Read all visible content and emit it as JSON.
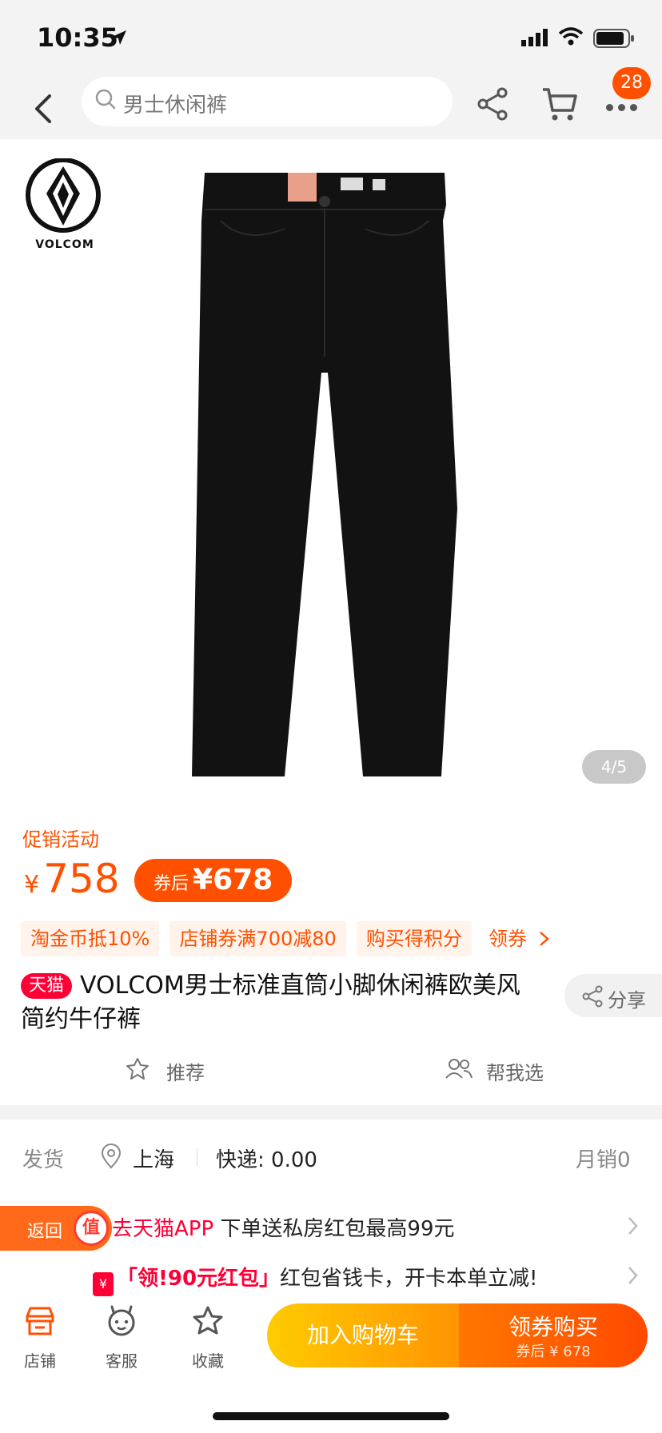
{
  "status_bar": {
    "time": "10:35"
  },
  "nav": {
    "search_placeholder": "男士休闲裤",
    "more_badge": "28"
  },
  "product": {
    "brand": "VOLCOM",
    "image_pager": "4/5",
    "promo_label": "促销活动",
    "currency": "¥",
    "price": "758",
    "coupon_price_label": "券后",
    "coupon_price": "¥678",
    "tags": [
      "淘金币抵10%",
      "店铺券满700减80",
      "购买得积分"
    ],
    "coupon_link": "领券",
    "store_badge": "天猫",
    "title": "VOLCOM男士标准直筒小脚休闲裤欧美风简约牛仔裤",
    "share_label": "分享",
    "recommend_label": "推荐",
    "help_choose_label": "帮我选"
  },
  "shipping": {
    "label": "发货",
    "city": "上海",
    "fee": "快递: 0.00",
    "monthly_sales": "月销0"
  },
  "promos": {
    "app_link": "去天猫APP",
    "app_text": "下单送私房红包最高99元",
    "redpack_icon": "¥",
    "redpack_title": "「领!90元红包」",
    "redpack_text": "红包省钱卡，开卡本单立减!"
  },
  "return_float": {
    "label": "返回",
    "icon_text": "值"
  },
  "bottom_bar": {
    "store_label": "店铺",
    "service_label": "客服",
    "favorite_label": "收藏",
    "add_cart_label": "加入购物车",
    "buy_label": "领券购买",
    "buy_sub_label": "券后 ¥ 678"
  },
  "colors": {
    "accent": "#ff5000",
    "tmall_red": "#ff0036"
  }
}
